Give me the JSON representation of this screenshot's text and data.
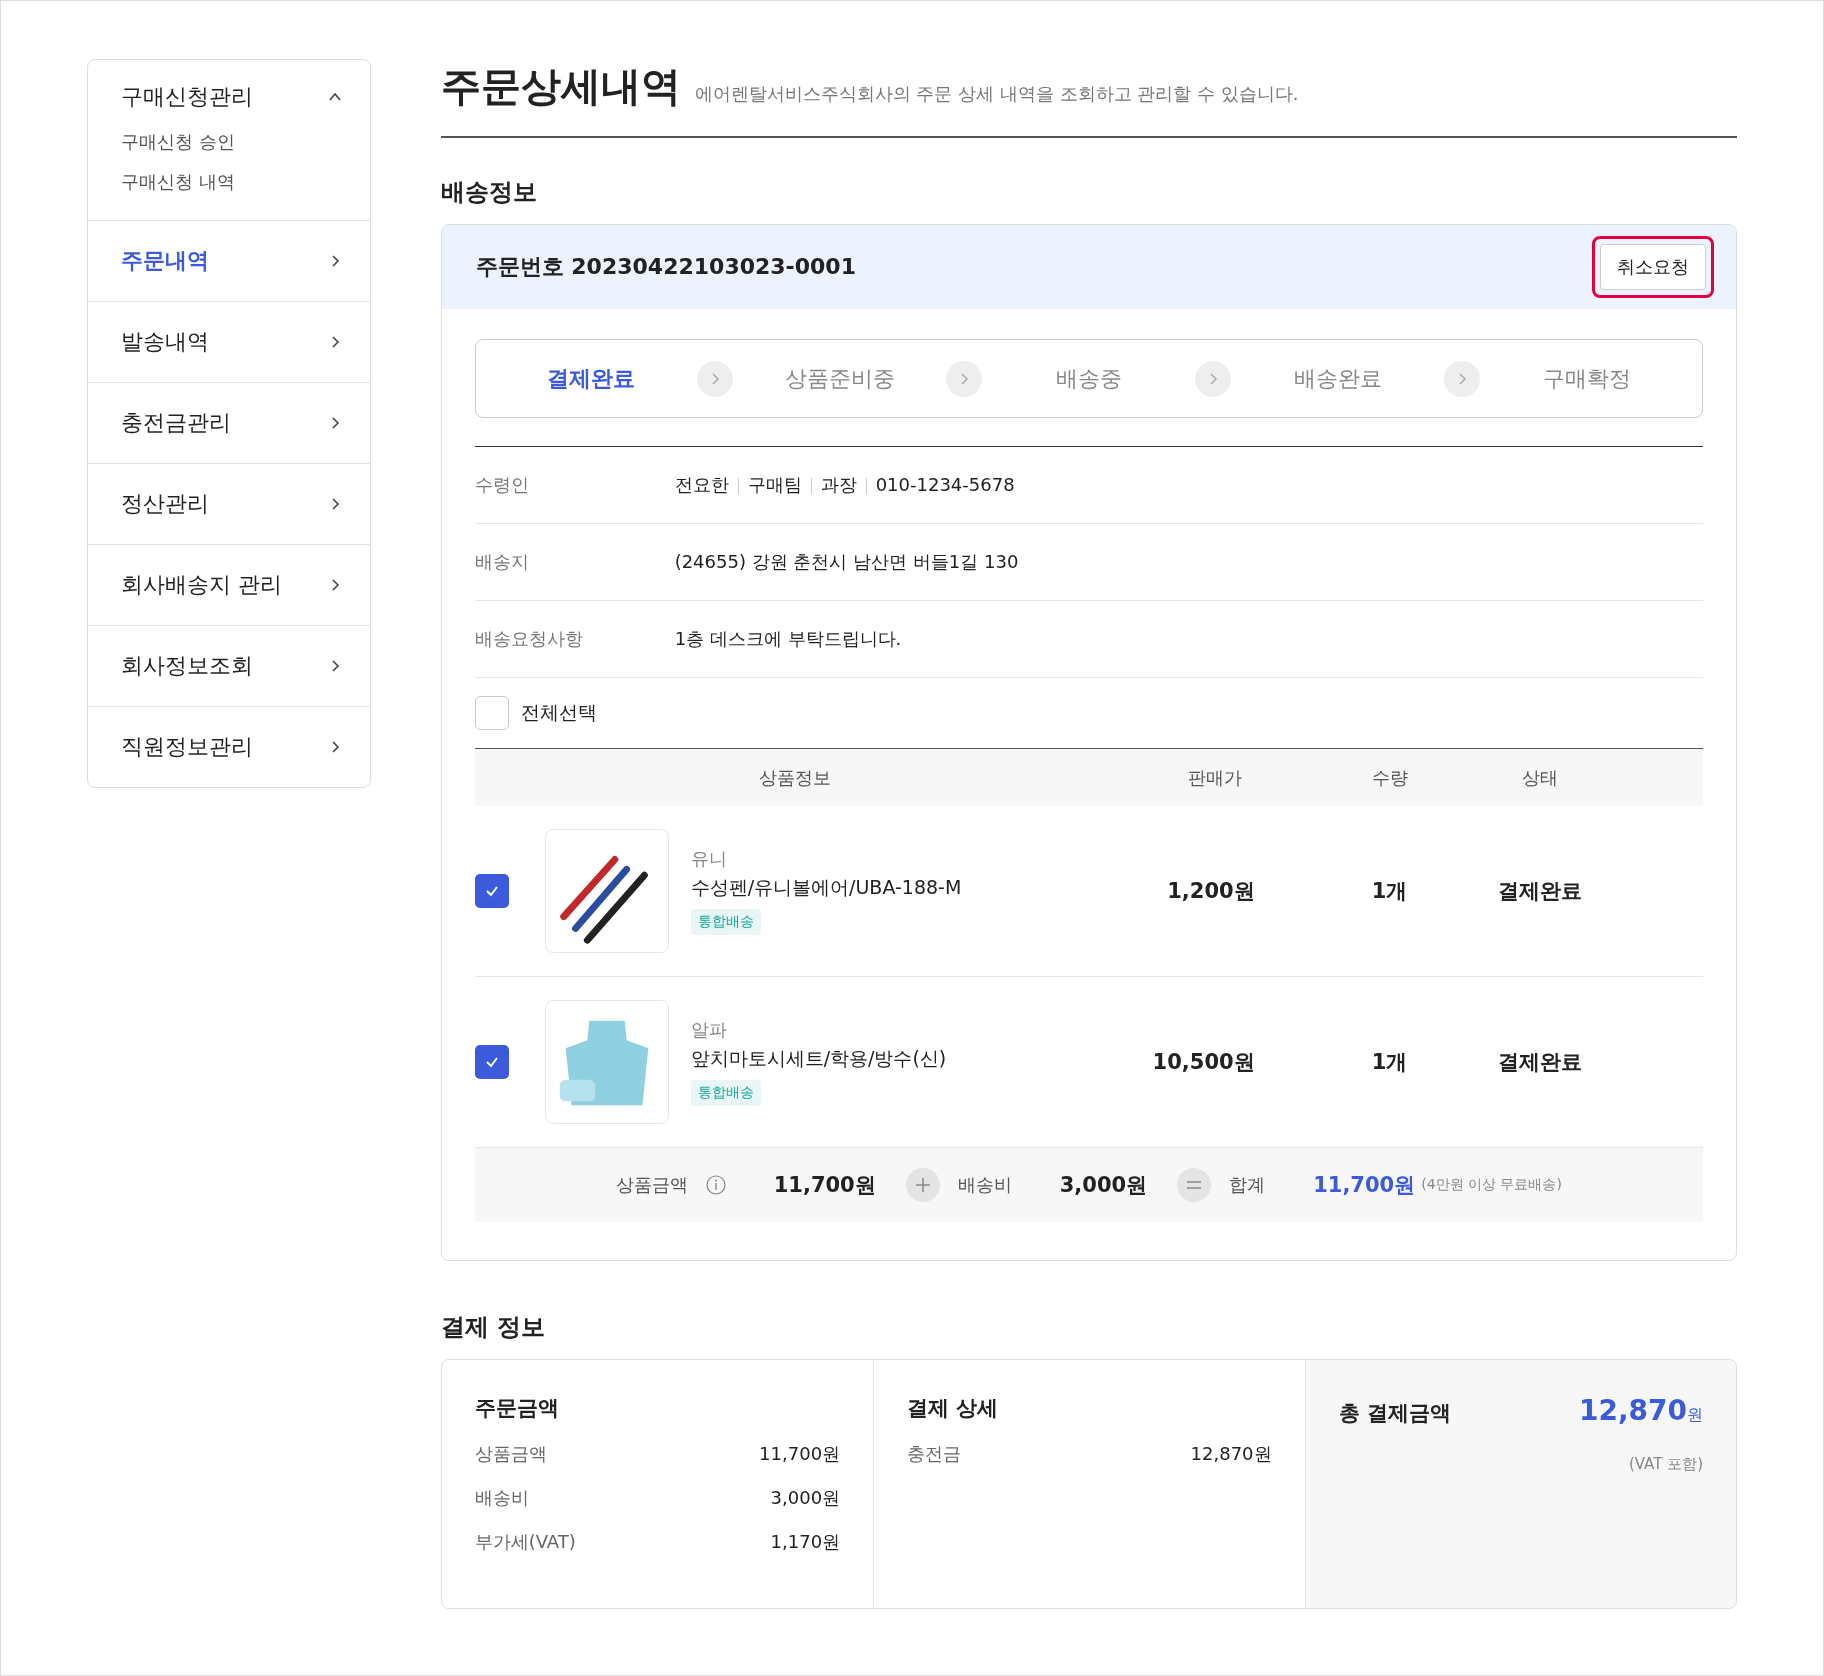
{
  "sidebar": {
    "groups": [
      {
        "label": "구매신청관리",
        "expanded": true,
        "selected": false,
        "children": [
          {
            "label": "구매신청 승인"
          },
          {
            "label": "구매신청 내역"
          }
        ]
      },
      {
        "label": "주문내역",
        "expanded": false,
        "selected": true
      },
      {
        "label": "발송내역",
        "expanded": false,
        "selected": false
      },
      {
        "label": "충전금관리",
        "expanded": false,
        "selected": false
      },
      {
        "label": "정산관리",
        "expanded": false,
        "selected": false
      },
      {
        "label": "회사배송지 관리",
        "expanded": false,
        "selected": false
      },
      {
        "label": "회사정보조회",
        "expanded": false,
        "selected": false
      },
      {
        "label": "직원정보관리",
        "expanded": false,
        "selected": false
      }
    ]
  },
  "page": {
    "title": "주문상세내역",
    "subtitle": "에어렌탈서비스주식회사의 주문 상세 내역을 조회하고 관리할 수 있습니다."
  },
  "shipping": {
    "heading": "배송정보",
    "order_number": "주문번호 20230422103023-0001",
    "cancel_button": "취소요청",
    "steps": [
      {
        "label": "결제완료",
        "selected": true
      },
      {
        "label": "상품준비중",
        "selected": false
      },
      {
        "label": "배송중",
        "selected": false
      },
      {
        "label": "배송완료",
        "selected": false
      },
      {
        "label": "구매확정",
        "selected": false
      }
    ],
    "info": [
      {
        "label": "수령인",
        "parts": [
          "전요한",
          "구매팀",
          "과장",
          "010-1234-5678"
        ]
      },
      {
        "label": "배송지",
        "parts": [
          "(24655) 강원 춘천시 남산면 버들1길 130"
        ]
      },
      {
        "label": "배송요청사항",
        "parts": [
          "1층 데스크에 부탁드립니다."
        ]
      }
    ],
    "select_all": {
      "label": "전체선택",
      "checked": false
    },
    "columns": [
      "상품정보",
      "판매가",
      "수량",
      "상태"
    ],
    "products": [
      {
        "brand": "유니",
        "name": "수성펜/유니볼에어/UBA-188-M",
        "tag": "통합배송",
        "price": "1,200원",
        "quantity": "1개",
        "status": "결제완료",
        "checked": true
      },
      {
        "brand": "알파",
        "name": "앞치마토시세트/학용/방수(신)",
        "tag": "통합배송",
        "price": "10,500원",
        "quantity": "1개",
        "status": "결제완료",
        "checked": true
      }
    ],
    "summary": {
      "product_label": "상품금액",
      "product_amount": "11,700원",
      "shipping_label": "배송비",
      "shipping_amount": "3,000원",
      "total_label": "합계",
      "total_amount": "11,700원",
      "note": "(4만원 이상 무료배송)"
    }
  },
  "payment": {
    "heading": "결제 정보",
    "order_amount": {
      "title": "주문금액",
      "rows": [
        {
          "label": "상품금액",
          "value": "11,700원"
        },
        {
          "label": "배송비",
          "value": "3,000원"
        },
        {
          "label": "부가세(VAT)",
          "value": "1,170원"
        }
      ]
    },
    "detail": {
      "title": "결제 상세",
      "rows": [
        {
          "label": "충전금",
          "value": "12,870원"
        }
      ]
    },
    "total": {
      "title": "총 결제금액",
      "amount": "12,870",
      "unit": "원",
      "note": "(VAT 포함)"
    }
  }
}
